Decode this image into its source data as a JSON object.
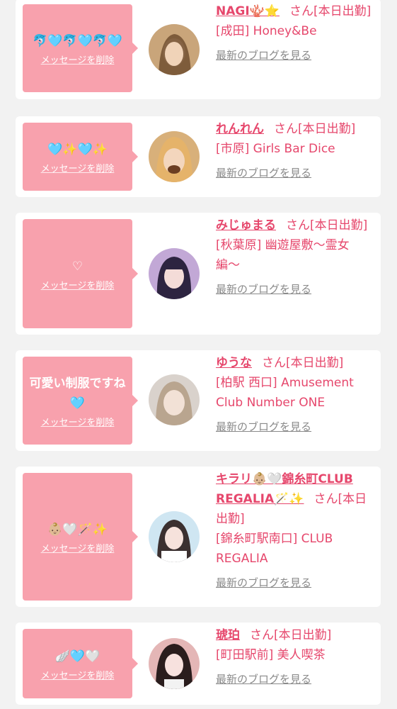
{
  "delete_label": "メッセージを削除",
  "blog_label": "最新のブログを見る",
  "suffix": "さん[本日出勤]",
  "cards": [
    {
      "message": "🐬🩵🐬🩵🐬🩵",
      "name": "NAGI🪸⭐️",
      "shop": "[成田] Honey&Be"
    },
    {
      "message": "🩵✨🩵✨",
      "name": "れんれん",
      "shop": "[市原] Girls Bar Dice"
    },
    {
      "message": "♡",
      "name": "みじゅまる",
      "shop": "[秋葉原] 幽遊屋敷〜霊女編〜"
    },
    {
      "message": "可愛い制服ですね🩵",
      "name": "ゆうな",
      "shop": "[柏駅 西口] Amusement Club Number ONE"
    },
    {
      "message": "👶🏼🤍🪄✨",
      "name": "キラリ👶🏼🤍錦糸町CLUB REGALIA🪄✨",
      "shop": "[錦糸町駅南口] CLUB REGALIA"
    },
    {
      "message": "🪽🩵🤍",
      "name": "琥珀",
      "shop": "[町田駅前] 美人喫茶"
    }
  ],
  "colors": {
    "accent": "#e6476c",
    "bubble": "#f8a1ad",
    "muted": "#8a8a8a"
  }
}
